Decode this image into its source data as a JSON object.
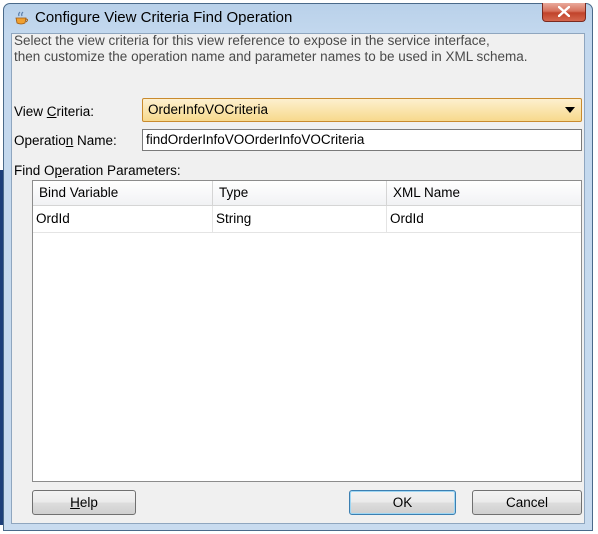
{
  "window": {
    "title": "Configure View Criteria Find Operation",
    "close_glyph": "x"
  },
  "intro_line1": "Select the view criteria for this view reference to expose in the service interface,",
  "intro_line2": "then customize the operation name and parameter names to be used in XML schema.",
  "view_criteria": {
    "label_pre": "View ",
    "label_mnemonic": "C",
    "label_post": "riteria:",
    "selected": "OrderInfoVOCriteria"
  },
  "operation_name": {
    "label_pre": "Operatio",
    "label_mnemonic": "n",
    "label_post": " Name:",
    "value": "findOrderInfoVOOrderInfoVOCriteria"
  },
  "params": {
    "label_pre": "Find O",
    "label_mnemonic": "p",
    "label_post": "eration Parameters:",
    "columns": [
      "Bind Variable",
      "Type",
      "XML Name"
    ],
    "rows": [
      {
        "bind_variable": "OrdId",
        "type": "String",
        "xml_name": "OrdId"
      }
    ]
  },
  "buttons": {
    "help_mnemonic": "H",
    "help_rest": "elp",
    "ok": "OK",
    "cancel": "Cancel"
  },
  "colors": {
    "accent_combo": "#f7d98c",
    "close_button": "#c1432b"
  },
  "icons": {
    "title": "jdeveloper-cup-icon",
    "close": "close-icon",
    "dropdown": "chevron-down-icon"
  }
}
